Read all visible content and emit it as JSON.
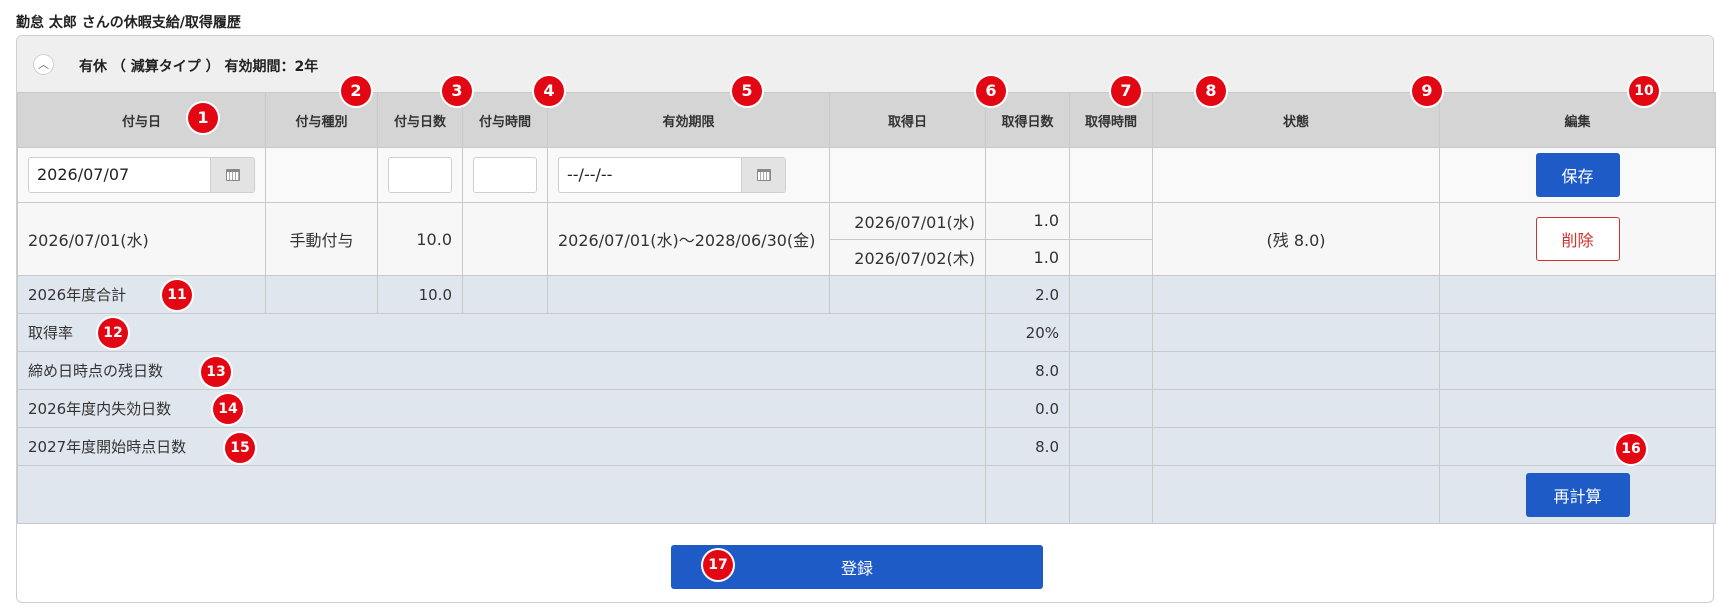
{
  "page_title": "勤怠 太郎 さんの休暇支給/取得履歴",
  "panel": {
    "title": "有休 （ 減算タイプ ） 有効期間：2年",
    "collapse_icon": "chevron-up-icon"
  },
  "columns": [
    "付与日",
    "付与種別",
    "付与日数",
    "付与時間",
    "有効期限",
    "取得日",
    "取得日数",
    "取得時間",
    "状態",
    "編集"
  ],
  "edit_row": {
    "grant_date": "2026/07/07",
    "grant_days": "",
    "grant_hours": "",
    "expiry_placeholder": "--/--/--",
    "save_label": "保存"
  },
  "grant_row": {
    "grant_date": "2026/07/01(水)",
    "grant_type": "手動付与",
    "grant_days": "10.0",
    "expiry": "2026/07/01(水)～2028/06/30(金)",
    "takes": [
      {
        "date": "2026/07/01(水)",
        "days": "1.0"
      },
      {
        "date": "2026/07/02(木)",
        "days": "1.0"
      }
    ],
    "status": "(残 8.0)",
    "delete_label": "削除"
  },
  "summary": {
    "total_label": "2026年度合計",
    "total_grant_days": "10.0",
    "total_taken_days": "2.0",
    "rate_label": "取得率",
    "rate_value": "20%",
    "remain_label": "締め日時点の残日数",
    "remain_value": "8.0",
    "expired_label": "2026年度内失効日数",
    "expired_value": "0.0",
    "next_label": "2027年度開始時点日数",
    "next_value": "8.0",
    "recalc_label": "再計算"
  },
  "register_label": "登録",
  "markers": [
    "1",
    "2",
    "3",
    "4",
    "5",
    "6",
    "7",
    "8",
    "9",
    "10",
    "11",
    "12",
    "13",
    "14",
    "15",
    "16",
    "17"
  ],
  "colors": {
    "accent": "#1f5bc6",
    "danger": "#d0322b",
    "marker": "#e30613",
    "summary_bg": "#e0e6ee"
  }
}
